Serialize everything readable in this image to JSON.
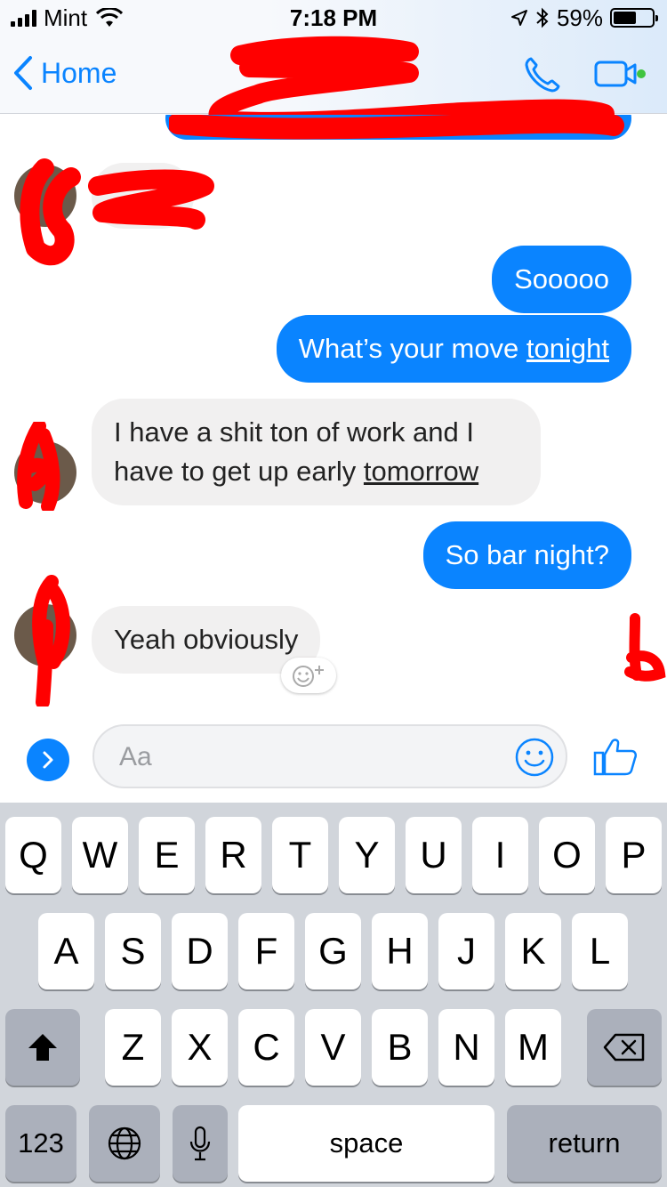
{
  "status_bar": {
    "carrier": "Mint",
    "time": "7:18 PM",
    "battery": "59%",
    "battery_level": 0.59
  },
  "nav": {
    "back_label": "Home"
  },
  "messages": [
    {
      "from": "me",
      "text": "Sooooo"
    },
    {
      "from": "me",
      "text_before": "What’s your move ",
      "text_link": "tonight"
    },
    {
      "from": "them",
      "line1": "I have a shit ton of work and I",
      "line2_before": "have to get up early ",
      "line2_link": "tomorrow"
    },
    {
      "from": "me",
      "text": "So bar night?"
    },
    {
      "from": "them",
      "text": "Yeah obviously"
    }
  ],
  "composer": {
    "placeholder": "Aa"
  },
  "keyboard": {
    "row1": [
      "Q",
      "W",
      "E",
      "R",
      "T",
      "Y",
      "U",
      "I",
      "O",
      "P"
    ],
    "row2": [
      "A",
      "S",
      "D",
      "F",
      "G",
      "H",
      "J",
      "K",
      "L"
    ],
    "row3": [
      "Z",
      "X",
      "C",
      "V",
      "B",
      "N",
      "M"
    ],
    "numbers_label": "123",
    "space_label": "space",
    "return_label": "return"
  },
  "colors": {
    "accent": "#0a84ff",
    "incoming_bubble": "#f1f0f0",
    "redaction": "#ff0000"
  }
}
